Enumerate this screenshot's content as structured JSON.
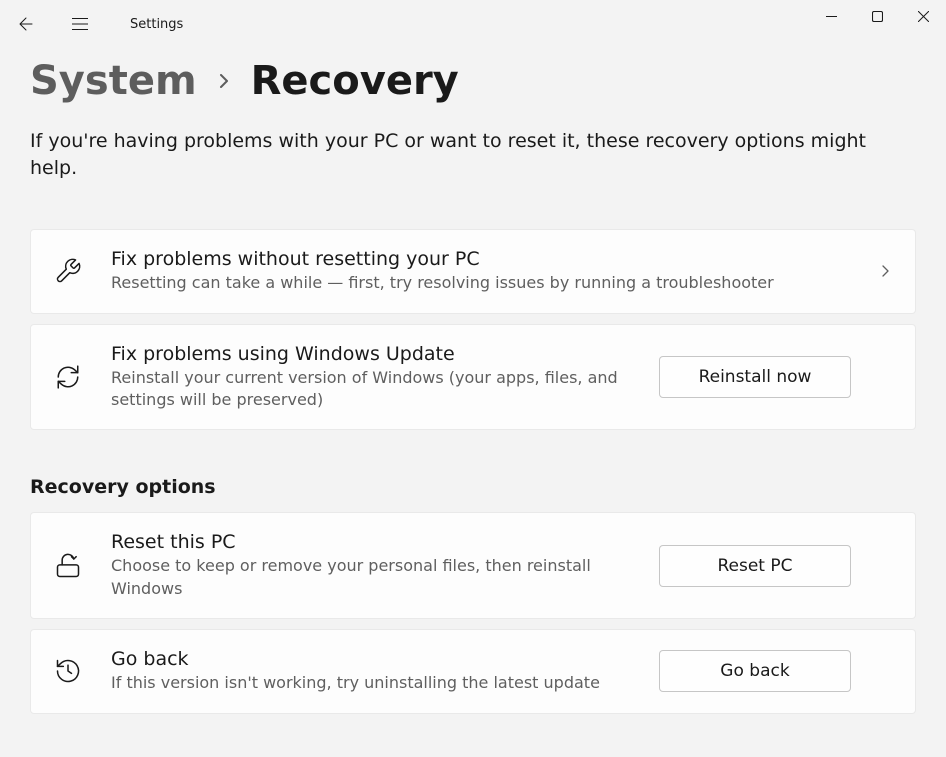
{
  "titlebar": {
    "app_name": "Settings"
  },
  "breadcrumb": {
    "parent": "System",
    "current": "Recovery"
  },
  "intro_text": "If you're having problems with your PC or want to reset it, these recovery options might help.",
  "cards": {
    "fix_problems": {
      "title": "Fix problems without resetting your PC",
      "desc": "Resetting can take a while — first, try resolving issues by running a troubleshooter"
    },
    "windows_update": {
      "title": "Fix problems using Windows Update",
      "desc": "Reinstall your current version of Windows (your apps, files, and settings will be preserved)",
      "button": "Reinstall now"
    }
  },
  "section_heading": "Recovery options",
  "recovery_cards": {
    "reset_pc": {
      "title": "Reset this PC",
      "desc": "Choose to keep or remove your personal files, then reinstall Windows",
      "button": "Reset PC"
    },
    "go_back": {
      "title": "Go back",
      "desc": "If this version isn't working, try uninstalling the latest update",
      "button": "Go back"
    }
  }
}
